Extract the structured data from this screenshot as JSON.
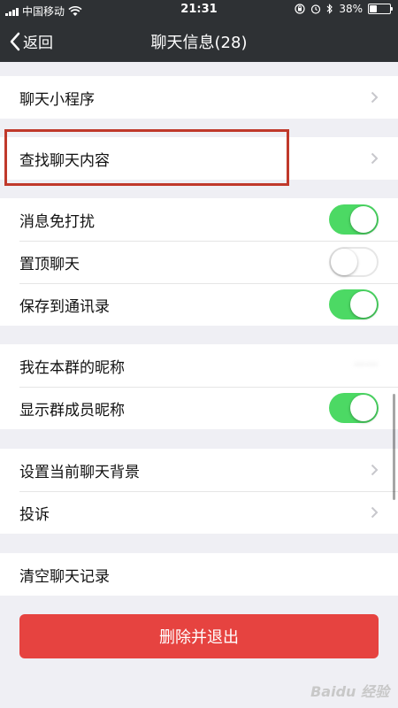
{
  "status_bar": {
    "carrier": "中国移动",
    "time": "21:31",
    "battery": "38%",
    "battery_level": 0.38
  },
  "nav": {
    "back_label": "返回",
    "title": "聊天信息(28)"
  },
  "sections": {
    "mini_programs": {
      "label": "聊天小程序"
    },
    "search": {
      "label": "查找聊天内容"
    },
    "mute": {
      "label": "消息免打扰",
      "on": true
    },
    "pin": {
      "label": "置顶聊天",
      "on": false
    },
    "save_contacts": {
      "label": "保存到通讯录",
      "on": true
    },
    "group_nickname": {
      "label": "我在本群的昵称",
      "value": "⋯⋯"
    },
    "show_nicknames": {
      "label": "显示群成员昵称",
      "on": true
    },
    "background": {
      "label": "设置当前聊天背景"
    },
    "complain": {
      "label": "投诉"
    },
    "clear_history": {
      "label": "清空聊天记录"
    }
  },
  "delete_button": {
    "label": "删除并退出"
  },
  "watermark": "Baidu 经验",
  "colors": {
    "nav_background": "#2e3134",
    "toggle_on": "#4cd964",
    "danger": "#e64340",
    "highlight": "#c0392b"
  }
}
